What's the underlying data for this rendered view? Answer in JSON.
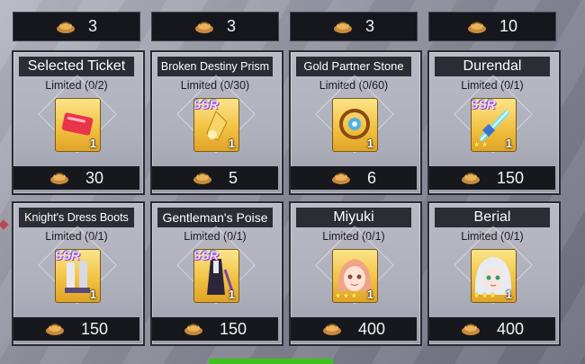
{
  "top_prices": [
    "3",
    "3",
    "3",
    "10"
  ],
  "cards": [
    {
      "title": "Selected Ticket",
      "limit": "Limited (0/2)",
      "qty": "1",
      "price": "30",
      "ssr": "",
      "stars": ""
    },
    {
      "title": "Broken Destiny Prism",
      "limit": "Limited (0/30)",
      "qty": "1",
      "price": "5",
      "ssr": "SSR",
      "stars": ""
    },
    {
      "title": "Gold Partner Stone",
      "limit": "Limited (0/60)",
      "qty": "1",
      "price": "6",
      "ssr": "",
      "stars": ""
    },
    {
      "title": "Durendal",
      "limit": "Limited (0/1)",
      "qty": "1",
      "price": "150",
      "ssr": "SSR",
      "stars": "★★"
    },
    {
      "title": "Knight's Dress Boots",
      "limit": "Limited (0/1)",
      "qty": "1",
      "price": "150",
      "ssr": "SSR",
      "stars": ""
    },
    {
      "title": "Gentleman's Poise",
      "limit": "Limited (0/1)",
      "qty": "1",
      "price": "150",
      "ssr": "SSR",
      "stars": ""
    },
    {
      "title": "Miyuki",
      "limit": "Limited (0/1)",
      "qty": "1",
      "price": "400",
      "ssr": "",
      "stars": "★★★"
    },
    {
      "title": "Berial",
      "limit": "Limited (0/1)",
      "qty": "1",
      "price": "400",
      "ssr": "",
      "stars": "★★★"
    }
  ],
  "icons": {
    "currency": "coin-pouch-icon"
  },
  "colors": {
    "price_bg": "#17181d",
    "item_gold": "#f3c244",
    "progress_green": "#3ec11f"
  }
}
